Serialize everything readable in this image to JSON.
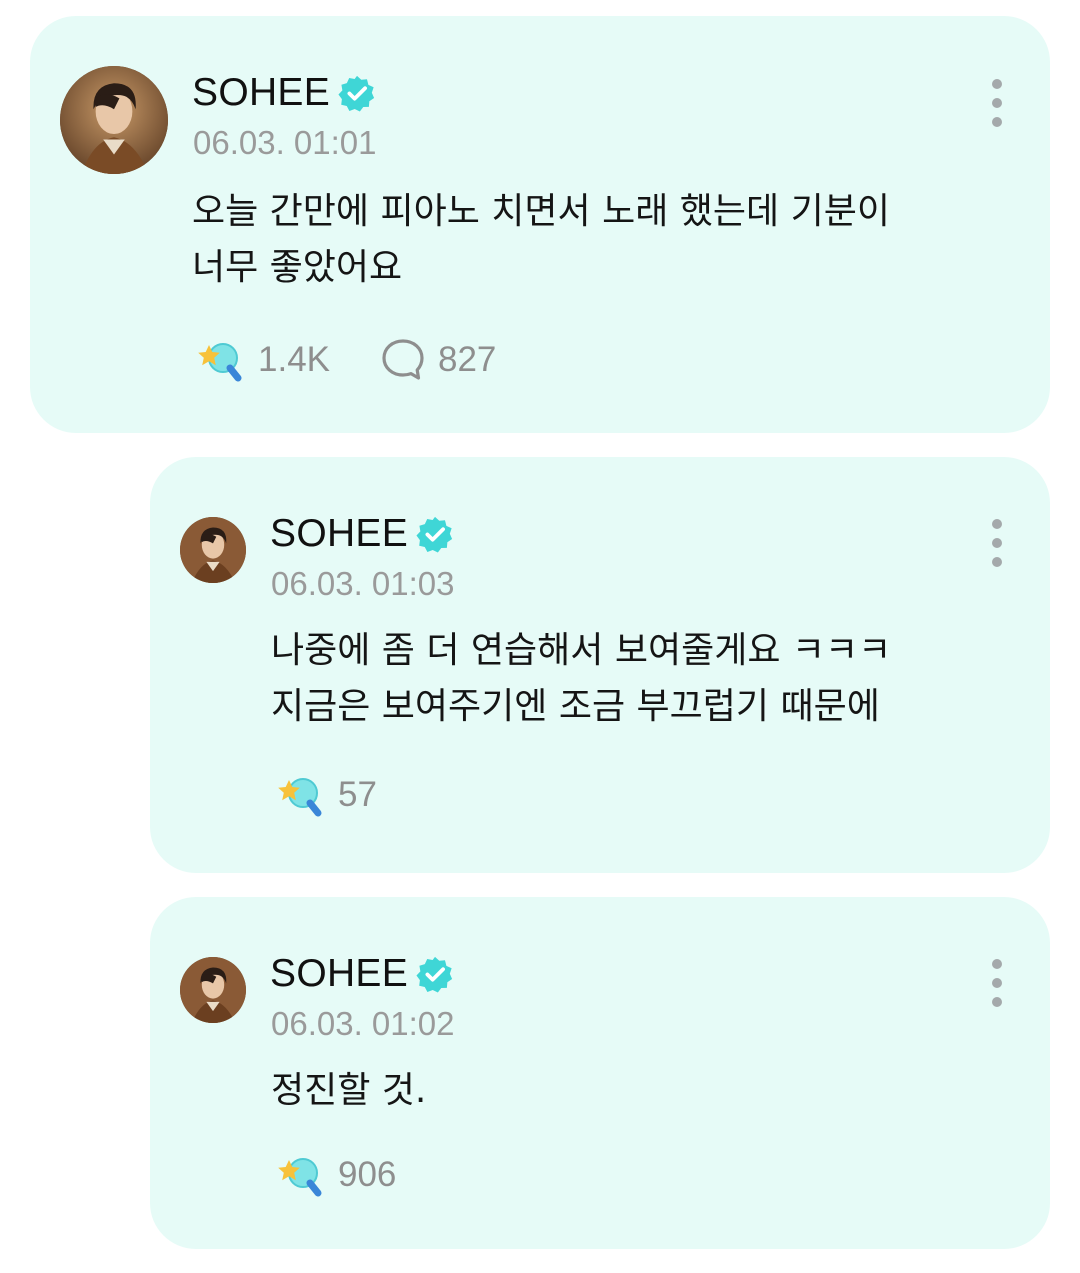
{
  "colors": {
    "card_background": "#e6fbf7",
    "verified_badge": "#3fd6d6",
    "muted_text": "#9a9a9a",
    "body_text": "#151515"
  },
  "post": {
    "author": "SOHEE",
    "timestamp": "06.03. 01:01",
    "text": "오늘 간만에 피아노 치면서 노래 했는데 기분이\n너무 좋았어요",
    "reaction_count": "1.4K",
    "comment_count": "827",
    "icons": [
      "avatar",
      "verified-icon",
      "more-icon",
      "reaction-icon",
      "comment-icon"
    ]
  },
  "replies": [
    {
      "author": "SOHEE",
      "timestamp": "06.03. 01:03",
      "text": "나중에 좀 더 연습해서 보여줄게요 ㅋㅋㅋ\n지금은 보여주기엔 조금 부끄럽기 때문에",
      "reaction_count": "57"
    },
    {
      "author": "SOHEE",
      "timestamp": "06.03. 01:02",
      "text": "정진할 것.",
      "reaction_count": "906"
    }
  ]
}
